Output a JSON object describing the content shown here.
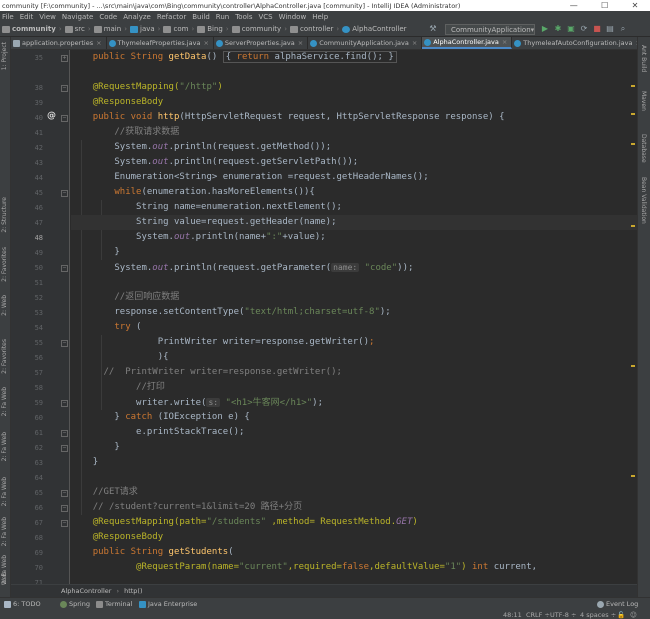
{
  "window": {
    "title": "community [F:\\community] - ...\\src\\main\\java\\com\\Bing\\community\\controller\\AlphaController.java [community] - IntelliJ IDEA (Administrator)",
    "controls": [
      "—",
      "☐",
      "✕"
    ]
  },
  "menu": [
    "File",
    "Edit",
    "View",
    "Navigate",
    "Code",
    "Analyze",
    "Refactor",
    "Build",
    "Run",
    "Tools",
    "VCS",
    "Window",
    "Help"
  ],
  "breadcrumb": [
    "community",
    "src",
    "main",
    "java",
    "com",
    "Bing",
    "community",
    "controller",
    "AlphaController"
  ],
  "run_config": "CommunityApplication",
  "tabs": [
    {
      "label": "application.properties",
      "color": "#9aa7b0"
    },
    {
      "label": "ThymeleafProperties.java",
      "color": "#3592c4"
    },
    {
      "label": "ServerProperties.java",
      "color": "#3592c4"
    },
    {
      "label": "CommunityApplication.java",
      "color": "#3592c4"
    },
    {
      "label": "AlphaController.java",
      "color": "#3592c4",
      "active": true
    },
    {
      "label": "ThymeleafAutoConfiguration.java",
      "color": "#3592c4"
    }
  ],
  "left_tools": [
    "1: Project",
    "2: Structure",
    "2: Favorites",
    "2: Web",
    "2: Favorites",
    "2: Fa Web",
    "2: Fa Web",
    "2: Fa Web",
    "2: Fa Web",
    "2: Fa Web",
    "Web"
  ],
  "right_tools": [
    "Ant Build",
    "Maven",
    "Database",
    "Bean Validation"
  ],
  "line_numbers": [
    "35",
    "38",
    "39",
    "40",
    "41",
    "42",
    "43",
    "44",
    "45",
    "46",
    "47",
    "48",
    "49",
    "50",
    "51",
    "52",
    "53",
    "54",
    "55",
    "56",
    "57",
    "58",
    "59",
    "60",
    "61",
    "62",
    "63",
    "64",
    "65",
    "66",
    "67",
    "68",
    "69",
    "70",
    "71"
  ],
  "current_line": "48",
  "code": {
    "l35a": "public String ",
    "l35b": "getData",
    "l35c": "() ",
    "l35d": "{ ",
    "l35e": "return ",
    "l35f": "alphaService.find(); }",
    "l39a": "@RequestMapping(",
    "l39b": "\"/http\"",
    "l39c": ")",
    "l40": "@ResponseBody",
    "l41a": "public void ",
    "l41b": "http",
    "l41c": "(HttpServletRequest request, HttpServletResponse response) {",
    "l42": "//获取请求数据",
    "l43a": "System.",
    "l43b": "out",
    "l43c": ".println(request.getMethod());",
    "l44a": "System.",
    "l44b": "out",
    "l44c": ".println(request.getServletPath());",
    "l45": "Enumeration<String> enumeration =request.getHeaderNames();",
    "l46a": "while",
    "l46b": "(enumeration.hasMoreElements()){",
    "l47": "String name=enumeration.nextElement();",
    "l48": "String value=request.getHeader(name);",
    "l49a": "System.",
    "l49b": "out",
    "l49c": ".println(name+",
    "l49d": "\":\"",
    "l49e": "+value);",
    "l50": "}",
    "l51a": "System.",
    "l51b": "out",
    "l51c": ".println(request.getParameter(",
    "l51d": "name:",
    "l51e": " \"code\"",
    "l51f": "));",
    "l53": "//返回响应数据",
    "l54a": "response.setContentType(",
    "l54b": "\"text/html;charset=utf-8\"",
    "l54c": ");",
    "l55a": "try ",
    "l55b": "(",
    "l56a": "PrintWriter writer=response.getWriter()",
    "l56b": ";",
    "l57": "){",
    "l58": "//  PrintWriter writer=response.getWriter();",
    "l59": "//打印",
    "l60a": "writer.write(",
    "l60b": "s:",
    "l60c": " \"<h1>牛客网</h1>\"",
    "l60d": ");",
    "l61a": "} ",
    "l61b": "catch ",
    "l61c": "(IOException e) {",
    "l62": "e.printStackTrace();",
    "l63": "}",
    "l64": "}",
    "l66": "//GET请求",
    "l67": "// /student?current=1&limit=20 路径+分页",
    "l68a": "@RequestMapping(path=",
    "l68b": "\"/students\"",
    "l68c": " ,method= RequestMethod.",
    "l68d": "GET",
    "l68e": ")",
    "l69": "@ResponseBody",
    "l70a": "public String ",
    "l70b": "getStudents",
    "l70c": "(",
    "l71a": "@RequestParam(name=",
    "l71b": "\"current\"",
    "l71c": ",required=",
    "l71d": "false",
    "l71e": ",defaultValue=",
    "l71f": "\"1\"",
    "l71g": ") ",
    "l71h": "int ",
    "l71i": "current,"
  },
  "footer_breadcrumb": [
    "AlphaController",
    "http()"
  ],
  "status_tools": [
    {
      "label": "6: TODO",
      "color": "#a9b7c6"
    },
    {
      "label": "Spring",
      "color": "#6a8759"
    },
    {
      "label": "Terminal",
      "color": "#8c8c8c"
    },
    {
      "label": "Java Enterprise",
      "color": "#3592c4"
    }
  ],
  "event_log": "Event Log",
  "status": {
    "position": "48:11",
    "line_sep": "CRLF ÷",
    "encoding": "UTF-8 ÷",
    "indent": "4 spaces ÷"
  }
}
